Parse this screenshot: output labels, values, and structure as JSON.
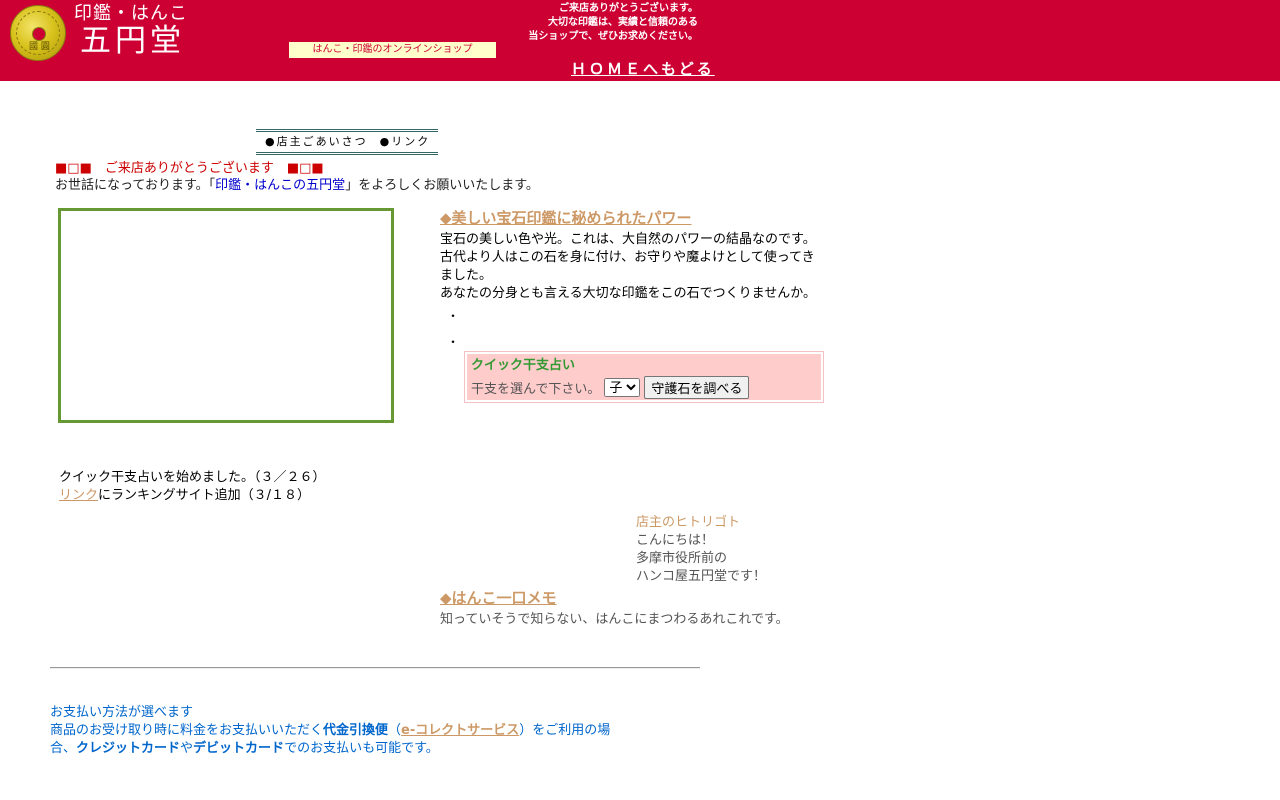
{
  "header": {
    "logo_sub": "印鑑・はんこ",
    "logo_main": "五円堂",
    "coin_text": "國 圓",
    "tagline": "はんこ・印鑑のオンラインショップ",
    "greeting": [
      "ご来店ありがとうございます。",
      "大切な印鑑は、実績と信頼のある",
      "当ショップで、ぜひお求めください。"
    ],
    "home_link": "ＨＯＭＥへもどる",
    "colors": {
      "background": "#cc0033",
      "tagline_bg": "#ffffcc"
    }
  },
  "nav": {
    "items": [
      "●店主ごあいさつ",
      "●リンク"
    ]
  },
  "welcome": {
    "banner": "■□■　ご来店ありがとうございます　■□■",
    "line_before": "お世話になっております。「",
    "shop_name": "印鑑・はんこの五円堂",
    "line_after": "」をよろしくお願いいたします。"
  },
  "gem_section": {
    "title": "◆美しい宝石印鑑に秘められたパワー",
    "body": "宝石の美しい色や光。これは、大自然のパワーの結晶なのです。古代より人はこの石を身に付け、お守りや魔よけとして使ってきました。\nあなたの分身とも言える大切な印鑑をこの石でつくりませんか。",
    "bullets": [
      "・",
      "・"
    ]
  },
  "quick_fortune": {
    "title": "クイック干支占い",
    "prompt": "干支を選んで下さい。",
    "selected": "子",
    "button": "守護石を調べる"
  },
  "news": {
    "line1": "クイック干支占いを始めました。（３／２６）",
    "line2_link": "リンク",
    "line2_rest": "にランキングサイト追加（３/１８）"
  },
  "hitorigoto": {
    "title": "店主のヒトリゴト",
    "lines": [
      "こんにちは！",
      "多摩市役所前の",
      "ハンコ屋五円堂です！"
    ]
  },
  "memo_section": {
    "title": "◆はんこ一口メモ",
    "body": "知っていそうで知らない、はんこにまつわるあれこれです。"
  },
  "payment": {
    "line1": "お支払い方法が選べます",
    "p1": "商品のお受け取り時に料金をお支払いいただく",
    "cod": "代金引換便",
    "p2": "（",
    "ecollect": "e-コレクトサービス",
    "p3": "）をご利用の場合、",
    "credit": "クレジットカード",
    "p4": "や",
    "debit": "デビットカード",
    "p5": "でのお支払いも可能です。"
  }
}
